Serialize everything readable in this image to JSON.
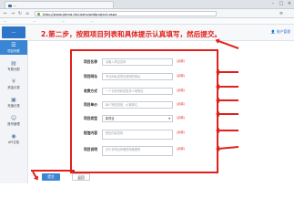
{
  "browser": {
    "tab_title": "...",
    "url": "http://www.jiema.hk/users/addproject.aspx",
    "bookmarks": [
      "...",
      "...",
      "...",
      "..."
    ]
  },
  "header": {
    "logo_text": "...",
    "user_menu": "账户管理"
  },
  "sidebar": {
    "items": [
      {
        "label": "项目列表",
        "icon": "list-icon",
        "active": true
      },
      {
        "label": "专属分配",
        "icon": "tag-icon",
        "active": false
      },
      {
        "label": "资金记录",
        "icon": "money-icon",
        "active": false
      },
      {
        "label": "充值记录",
        "icon": "recharge-icon",
        "active": false
      },
      {
        "label": "账号管理",
        "icon": "user-icon",
        "active": false
      },
      {
        "label": "API文档",
        "icon": "doc-icon",
        "active": false
      }
    ]
  },
  "annotation": {
    "text": "2.第二步，按照项目列表和具体提示认真填写，然后提交。",
    "color": "#e1201b"
  },
  "form": {
    "rows": [
      {
        "label": "项目名称",
        "placeholder": "请输入项目名称",
        "hint": "(必填)"
      },
      {
        "label": "项目网址",
        "placeholder": "专业网址或项目官网的网址",
        "hint": "(必填)"
      },
      {
        "label": "收费方式",
        "placeholder": "一个手机号码收发多少条短信",
        "hint": "(必填)"
      },
      {
        "label": "项目单价",
        "placeholder": "每个短信费用，价格单位",
        "hint": "(必填)"
      },
      {
        "label": "项目类型",
        "value": "新项目",
        "hint": "(必填)"
      },
      {
        "label": "短信内容",
        "placeholder": "短信内容范例",
        "hint": "(必填)"
      },
      {
        "label": "项目说明",
        "placeholder": "对于本项目有哪些特殊要求",
        "hint": "(必填)"
      }
    ]
  },
  "buttons": {
    "submit": "提交",
    "back": "返回"
  },
  "colors": {
    "accent": "#3b86d4",
    "annotation": "#e1201b"
  }
}
